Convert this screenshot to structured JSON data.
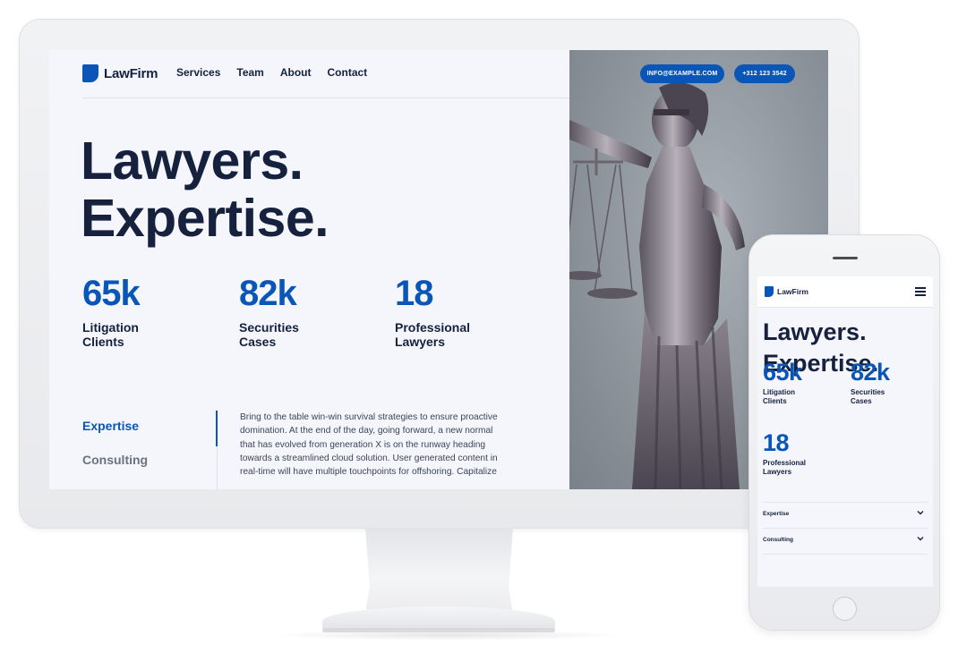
{
  "brand": {
    "name": "LawFirm",
    "accent_color": "#0a56b8",
    "text_color": "#16213e"
  },
  "desktop": {
    "nav": [
      "Services",
      "Team",
      "About",
      "Contact"
    ],
    "contact": {
      "email": "INFO@EXAMPLE.COM",
      "phone": "+312 123 3542"
    },
    "hero": {
      "line1": "Lawyers.",
      "line2": "Expertise."
    },
    "stats": [
      {
        "value": "65k",
        "label": "Litigation Clients"
      },
      {
        "value": "82k",
        "label": "Securities Cases"
      },
      {
        "value": "18",
        "label": "Professional Lawyers"
      }
    ],
    "tabs": {
      "active": "Expertise",
      "inactive": "Consulting"
    },
    "body_text": "Bring to the table win-win survival strategies to ensure proactive domination. At the end of the day, going forward, a new normal that has evolved from generation X is on the runway heading towards a streamlined cloud solution. User generated content in real-time will have multiple touchpoints for offshoring. Capitalize",
    "photo": {
      "subject": "lady-justice-statue"
    }
  },
  "mobile": {
    "brand_name": "LawFirm",
    "menu_icon": "hamburger-icon",
    "hero": {
      "line1": "Lawyers.",
      "line2": "Expertise."
    },
    "stats": [
      {
        "value": "65k",
        "label": "Litigation Clients"
      },
      {
        "value": "82k",
        "label": "Securities Cases"
      },
      {
        "value": "18",
        "label": "Professional Lawyers"
      }
    ],
    "accordion": [
      "Expertise",
      "Consulting"
    ]
  }
}
